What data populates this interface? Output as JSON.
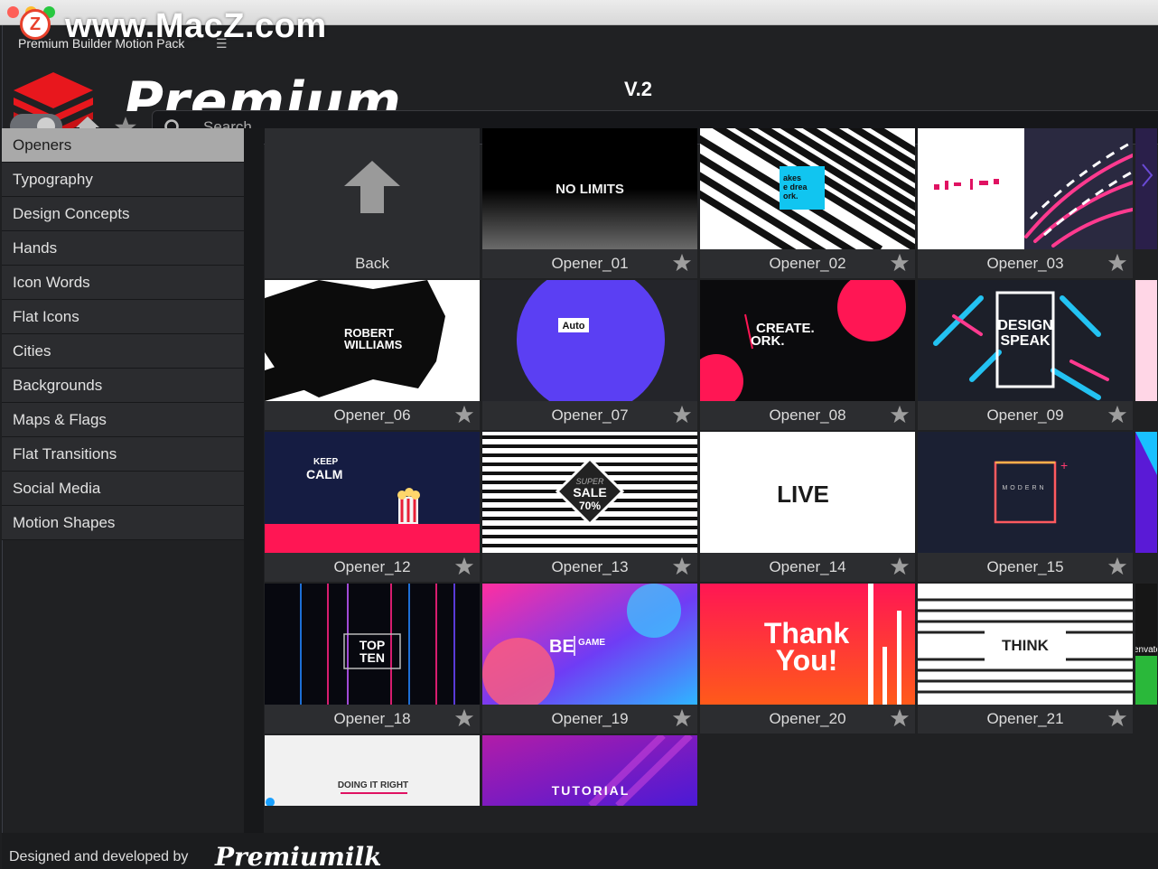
{
  "watermark": {
    "badge": "Z",
    "text": "www.MacZ.com"
  },
  "panel": {
    "title": "Premium Builder Motion Pack",
    "menu_icon": "hamburger-icon"
  },
  "brand": {
    "name": "Premium Builder",
    "version": "V.2"
  },
  "search": {
    "placeholder": "Search..."
  },
  "categories": [
    "Openers",
    "Typography",
    "Design Concepts",
    "Hands",
    "Icon Words",
    "Flat Icons",
    "Cities",
    "Backgrounds",
    "Maps & Flags",
    "Flat Transitions",
    "Social Media",
    "Motion Shapes"
  ],
  "active_category": "Openers",
  "tiles": [
    {
      "label": "Back"
    },
    {
      "label": "Opener_01",
      "thumb_text": "NO LIMITS"
    },
    {
      "label": "Opener_02",
      "thumb_text": "akes\ne drea\nork."
    },
    {
      "label": "Opener_03"
    },
    {
      "label": "Opener_06",
      "thumb_text": "ROBERT WILLIAMS"
    },
    {
      "label": "Opener_07",
      "thumb_text": "Auto"
    },
    {
      "label": "Opener_08",
      "thumb_text": "CREATE. ORK."
    },
    {
      "label": "Opener_09",
      "thumb_text": "DESIGN SPEAK"
    },
    {
      "label": "Opener_12",
      "thumb_text": "KEEP CALM"
    },
    {
      "label": "Opener_13",
      "thumb_text": "SUPER SALE 70%"
    },
    {
      "label": "Opener_14",
      "thumb_text": "LIVE"
    },
    {
      "label": "Opener_15",
      "thumb_text": "MODERN"
    },
    {
      "label": "Opener_18",
      "thumb_text": "TOP TEN"
    },
    {
      "label": "Opener_19",
      "thumb_text": "BE GAME"
    },
    {
      "label": "Opener_20",
      "thumb_text": "Thank You!"
    },
    {
      "label": "Opener_21",
      "thumb_text": "THINK"
    },
    {
      "label": "",
      "thumb_text": "DOING IT RIGHT"
    },
    {
      "label": "",
      "thumb_text": "TUTORIAL"
    }
  ],
  "edge_text": "envato",
  "footer": {
    "credit": "Designed and developed by",
    "brand": "Premiumilk"
  },
  "colors": {
    "accent_red": "#e8171d",
    "active_bg": "#a9a9a9",
    "panel_bg": "#202123"
  }
}
